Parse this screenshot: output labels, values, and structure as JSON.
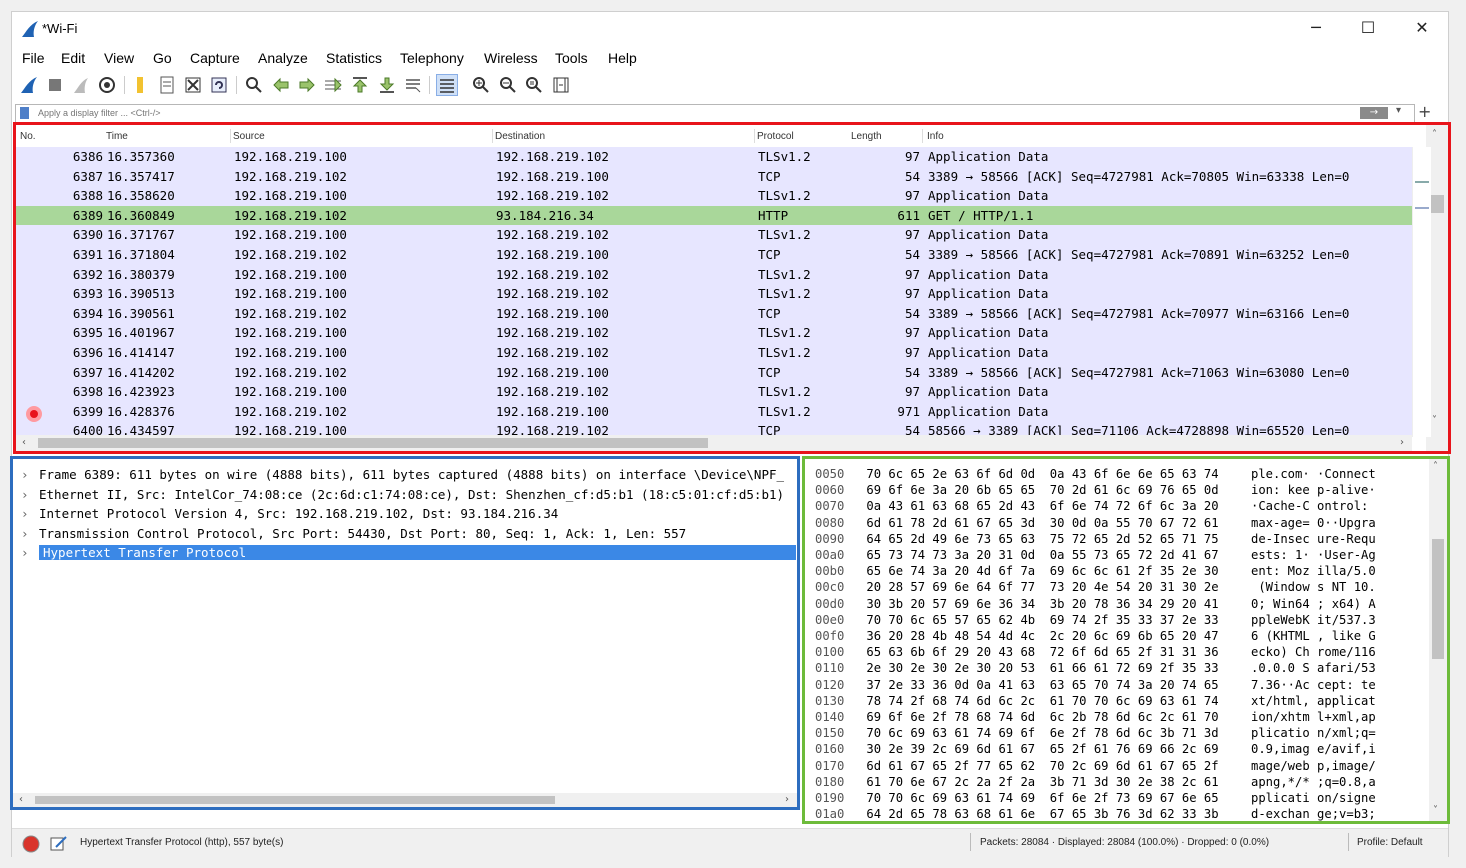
{
  "window": {
    "title": "*Wi-Fi"
  },
  "menu": [
    "File",
    "Edit",
    "View",
    "Go",
    "Capture",
    "Analyze",
    "Statistics",
    "Telephony",
    "Wireless",
    "Tools",
    "Help"
  ],
  "filter": {
    "placeholder": "Apply a display filter ... <Ctrl-/>"
  },
  "packet_list": {
    "columns": {
      "no": "No.",
      "time": "Time",
      "source": "Source",
      "destination": "Destination",
      "protocol": "Protocol",
      "length": "Length",
      "info": "Info"
    },
    "rows": [
      {
        "no": "6386",
        "time": "16.357360",
        "src": "192.168.219.100",
        "dst": "192.168.219.102",
        "proto": "TLSv1.2",
        "len": "97",
        "info": "Application Data"
      },
      {
        "no": "6387",
        "time": "16.357417",
        "src": "192.168.219.102",
        "dst": "192.168.219.100",
        "proto": "TCP",
        "len": "54",
        "info": "3389 → 58566 [ACK] Seq=4727981 Ack=70805 Win=63338 Len=0"
      },
      {
        "no": "6388",
        "time": "16.358620",
        "src": "192.168.219.100",
        "dst": "192.168.219.102",
        "proto": "TLSv1.2",
        "len": "97",
        "info": "Application Data"
      },
      {
        "no": "6389",
        "time": "16.360849",
        "src": "192.168.219.102",
        "dst": "93.184.216.34",
        "proto": "HTTP",
        "len": "611",
        "info": "GET / HTTP/1.1"
      },
      {
        "no": "6390",
        "time": "16.371767",
        "src": "192.168.219.100",
        "dst": "192.168.219.102",
        "proto": "TLSv1.2",
        "len": "97",
        "info": "Application Data"
      },
      {
        "no": "6391",
        "time": "16.371804",
        "src": "192.168.219.102",
        "dst": "192.168.219.100",
        "proto": "TCP",
        "len": "54",
        "info": "3389 → 58566 [ACK] Seq=4727981 Ack=70891 Win=63252 Len=0"
      },
      {
        "no": "6392",
        "time": "16.380379",
        "src": "192.168.219.100",
        "dst": "192.168.219.102",
        "proto": "TLSv1.2",
        "len": "97",
        "info": "Application Data"
      },
      {
        "no": "6393",
        "time": "16.390513",
        "src": "192.168.219.100",
        "dst": "192.168.219.102",
        "proto": "TLSv1.2",
        "len": "97",
        "info": "Application Data"
      },
      {
        "no": "6394",
        "time": "16.390561",
        "src": "192.168.219.102",
        "dst": "192.168.219.100",
        "proto": "TCP",
        "len": "54",
        "info": "3389 → 58566 [ACK] Seq=4727981 Ack=70977 Win=63166 Len=0"
      },
      {
        "no": "6395",
        "time": "16.401967",
        "src": "192.168.219.100",
        "dst": "192.168.219.102",
        "proto": "TLSv1.2",
        "len": "97",
        "info": "Application Data"
      },
      {
        "no": "6396",
        "time": "16.414147",
        "src": "192.168.219.100",
        "dst": "192.168.219.102",
        "proto": "TLSv1.2",
        "len": "97",
        "info": "Application Data"
      },
      {
        "no": "6397",
        "time": "16.414202",
        "src": "192.168.219.102",
        "dst": "192.168.219.100",
        "proto": "TCP",
        "len": "54",
        "info": "3389 → 58566 [ACK] Seq=4727981 Ack=71063 Win=63080 Len=0"
      },
      {
        "no": "6398",
        "time": "16.423923",
        "src": "192.168.219.100",
        "dst": "192.168.219.102",
        "proto": "TLSv1.2",
        "len": "97",
        "info": "Application Data"
      },
      {
        "no": "6399",
        "time": "16.428376",
        "src": "192.168.219.102",
        "dst": "192.168.219.100",
        "proto": "TLSv1.2",
        "len": "971",
        "info": "Application Data"
      },
      {
        "no": "6400",
        "time": "16.434597",
        "src": "192.168.219.100",
        "dst": "192.168.219.102",
        "proto": "TCP",
        "len": "54",
        "info": "58566 → 3389 [ACK] Seq=71106 Ack=4728898 Win=65520 Len=0"
      }
    ],
    "selected_row": 3
  },
  "details": [
    "Frame 6389: 611 bytes on wire (4888 bits), 611 bytes captured (4888 bits) on interface \\Device\\NPF_",
    "Ethernet II, Src: IntelCor_74:08:ce (2c:6d:c1:74:08:ce), Dst: Shenzhen_cf:d5:b1 (18:c5:01:cf:d5:b1)",
    "Internet Protocol Version 4, Src: 192.168.219.102, Dst: 93.184.216.34",
    "Transmission Control Protocol, Src Port: 54430, Dst Port: 80, Seq: 1, Ack: 1, Len: 557",
    "Hypertext Transfer Protocol"
  ],
  "bytes": [
    {
      "off": "0050",
      "hex": "70 6c 65 2e 63 6f 6d 0d  0a 43 6f 6e 6e 65 63 74",
      "asc": "ple.com· ·Connect"
    },
    {
      "off": "0060",
      "hex": "69 6f 6e 3a 20 6b 65 65  70 2d 61 6c 69 76 65 0d",
      "asc": "ion: kee p-alive·"
    },
    {
      "off": "0070",
      "hex": "0a 43 61 63 68 65 2d 43  6f 6e 74 72 6f 6c 3a 20",
      "asc": "·Cache-C ontrol: "
    },
    {
      "off": "0080",
      "hex": "6d 61 78 2d 61 67 65 3d  30 0d 0a 55 70 67 72 61",
      "asc": "max-age= 0··Upgra"
    },
    {
      "off": "0090",
      "hex": "64 65 2d 49 6e 73 65 63  75 72 65 2d 52 65 71 75",
      "asc": "de-Insec ure-Requ"
    },
    {
      "off": "00a0",
      "hex": "65 73 74 73 3a 20 31 0d  0a 55 73 65 72 2d 41 67",
      "asc": "ests: 1· ·User-Ag"
    },
    {
      "off": "00b0",
      "hex": "65 6e 74 3a 20 4d 6f 7a  69 6c 6c 61 2f 35 2e 30",
      "asc": "ent: Moz illa/5.0"
    },
    {
      "off": "00c0",
      "hex": "20 28 57 69 6e 64 6f 77  73 20 4e 54 20 31 30 2e",
      "asc": " (Window s NT 10."
    },
    {
      "off": "00d0",
      "hex": "30 3b 20 57 69 6e 36 34  3b 20 78 36 34 29 20 41",
      "asc": "0; Win64 ; x64) A"
    },
    {
      "off": "00e0",
      "hex": "70 70 6c 65 57 65 62 4b  69 74 2f 35 33 37 2e 33",
      "asc": "ppleWebK it/537.3"
    },
    {
      "off": "00f0",
      "hex": "36 20 28 4b 48 54 4d 4c  2c 20 6c 69 6b 65 20 47",
      "asc": "6 (KHTML , like G"
    },
    {
      "off": "0100",
      "hex": "65 63 6b 6f 29 20 43 68  72 6f 6d 65 2f 31 31 36",
      "asc": "ecko) Ch rome/116"
    },
    {
      "off": "0110",
      "hex": "2e 30 2e 30 2e 30 20 53  61 66 61 72 69 2f 35 33",
      "asc": ".0.0.0 S afari/53"
    },
    {
      "off": "0120",
      "hex": "37 2e 33 36 0d 0a 41 63  63 65 70 74 3a 20 74 65",
      "asc": "7.36··Ac cept: te"
    },
    {
      "off": "0130",
      "hex": "78 74 2f 68 74 6d 6c 2c  61 70 70 6c 69 63 61 74",
      "asc": "xt/html, applicat"
    },
    {
      "off": "0140",
      "hex": "69 6f 6e 2f 78 68 74 6d  6c 2b 78 6d 6c 2c 61 70",
      "asc": "ion/xhtm l+xml,ap"
    },
    {
      "off": "0150",
      "hex": "70 6c 69 63 61 74 69 6f  6e 2f 78 6d 6c 3b 71 3d",
      "asc": "plicatio n/xml;q="
    },
    {
      "off": "0160",
      "hex": "30 2e 39 2c 69 6d 61 67  65 2f 61 76 69 66 2c 69",
      "asc": "0.9,imag e/avif,i"
    },
    {
      "off": "0170",
      "hex": "6d 61 67 65 2f 77 65 62  70 2c 69 6d 61 67 65 2f",
      "asc": "mage/web p,image/"
    },
    {
      "off": "0180",
      "hex": "61 70 6e 67 2c 2a 2f 2a  3b 71 3d 30 2e 38 2c 61",
      "asc": "apng,*/* ;q=0.8,a"
    },
    {
      "off": "0190",
      "hex": "70 70 6c 69 63 61 74 69  6f 6e 2f 73 69 67 6e 65",
      "asc": "pplicati on/signe"
    },
    {
      "off": "01a0",
      "hex": "64 2d 65 78 63 68 61 6e  67 65 3b 76 3d 62 33 3b",
      "asc": "d-exchan ge;v=b3;"
    }
  ],
  "status": {
    "left": "Hypertext Transfer Protocol (http), 557 byte(s)",
    "stats": "Packets: 28084 · Displayed: 28084 (100.0%) · Dropped: 0 (0.0%)",
    "profile": "Profile: Default"
  },
  "colors": {
    "list_border": "#e8141b",
    "detail_border": "#2d6dbf",
    "bytes_border": "#6dbb3a",
    "row_bg": "#e7e6ff",
    "row_selected": "#a9d79a",
    "tree_selected": "#3b88e6"
  }
}
